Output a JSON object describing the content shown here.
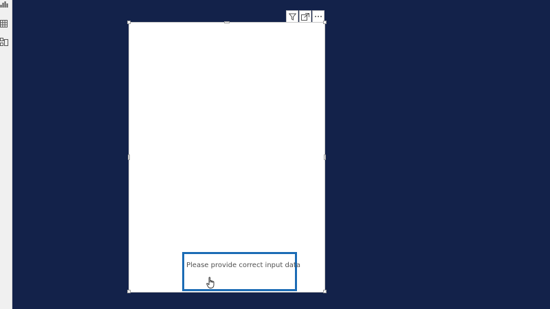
{
  "left_rail": {
    "icons": [
      "report-icon",
      "table-icon",
      "model-icon"
    ]
  },
  "visual_header": {
    "icons": [
      "filter-icon",
      "focus-mode-icon",
      "more-options-icon"
    ]
  },
  "visual": {
    "message": "Please provide correct input data"
  },
  "colors": {
    "background": "#13224a",
    "visual_bg": "#ffffff",
    "highlight_border": "#1c6cb5",
    "message_text": "#505050"
  }
}
